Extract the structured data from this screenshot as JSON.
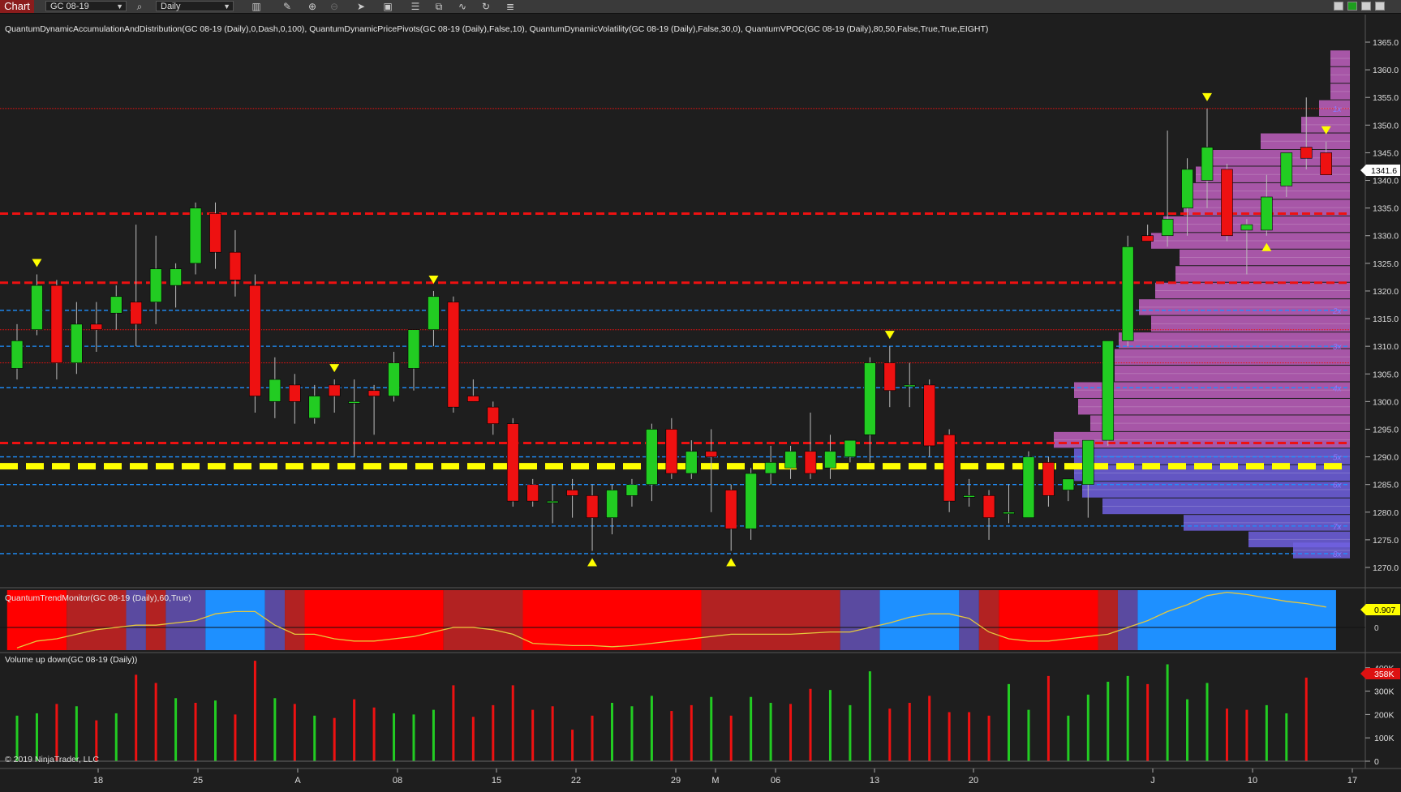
{
  "toolbar": {
    "chart_tab": "Chart",
    "instrument": "GC 08-19",
    "interval": "Daily",
    "icons": [
      "bar-type-icon",
      "pencil-icon",
      "zoom-in-icon",
      "zoom-out-icon",
      "pointer-icon",
      "data-box-icon",
      "properties-icon",
      "strategies-icon",
      "indicators-icon",
      "refresh-icon",
      "menu-icon"
    ],
    "window_colors": {
      "minimize": "#cccccc",
      "maximize": "#1e9e1e",
      "close": "#cfcfcf"
    }
  },
  "main_panel": {
    "indicators_label": "QuantumDynamicAccumulationAndDistribution(GC 08-19 (Daily),0,Dash,0,100), QuantumDynamicPricePivots(GC 08-19 (Daily),False,10), QuantumDynamicVolatility(GC 08-19 (Daily),False,30,0), QuantumVPOC(GC 08-19 (Daily),80,50,False,True,True,EIGHT)",
    "current_price_label": "1341.6",
    "y_ticks": [
      "1365.0",
      "1360.0",
      "1355.0",
      "1350.0",
      "1345.0",
      "1340.0",
      "1335.0",
      "1330.0",
      "1325.0",
      "1320.0",
      "1315.0",
      "1310.0",
      "1305.0",
      "1300.0",
      "1295.0",
      "1290.0",
      "1285.0",
      "1280.0",
      "1275.0",
      "1270.0"
    ],
    "vpoc_markers": [
      "1x",
      "2x",
      "3x",
      "4x",
      "5x",
      "6x",
      "7x",
      "8x"
    ]
  },
  "trend_panel": {
    "label": "QuantumTrendMonitor(GC 08-19 (Daily),60,True)",
    "value_badge": "0.907",
    "zero_label": "0"
  },
  "volume_panel": {
    "label": "Volume up down(GC 08-19 (Daily))",
    "badge": "358K",
    "y_ticks": [
      "400K",
      "300K",
      "200K",
      "100K",
      "0"
    ],
    "copyright": "© 2019 NinjaTrader, LLC"
  },
  "x_axis": {
    "labels": [
      "18",
      "25",
      "A",
      "08",
      "15",
      "22",
      "29",
      "M",
      "06",
      "13",
      "20",
      "J",
      "10",
      "17"
    ]
  },
  "colors": {
    "background": "#1e1e1e",
    "up_candle": "#22cc22",
    "down_candle": "#ee1111",
    "pivot_marker": "#ffff00",
    "vpoc_line": "#ffff00",
    "resistance_line": "#ee1111",
    "volatility_line": "#1e90ff",
    "profile_up": "#c060c0",
    "profile_down": "#7060e0",
    "trend_line": "#e6c83c"
  },
  "chart_data": {
    "type": "candlestick",
    "ylim": [
      1267,
      1368
    ],
    "candles": [
      {
        "o": 1306,
        "h": 1314,
        "l": 1304,
        "c": 1311
      },
      {
        "o": 1313,
        "h": 1323,
        "l": 1312,
        "c": 1321
      },
      {
        "o": 1321,
        "h": 1322,
        "l": 1304,
        "c": 1307
      },
      {
        "o": 1307,
        "h": 1318,
        "l": 1305,
        "c": 1314
      },
      {
        "o": 1314,
        "h": 1318,
        "l": 1309,
        "c": 1313
      },
      {
        "o": 1316,
        "h": 1321,
        "l": 1313,
        "c": 1319
      },
      {
        "o": 1318,
        "h": 1332,
        "l": 1310,
        "c": 1314
      },
      {
        "o": 1318,
        "h": 1330,
        "l": 1314,
        "c": 1324
      },
      {
        "o": 1321,
        "h": 1325,
        "l": 1317,
        "c": 1324
      },
      {
        "o": 1325,
        "h": 1336,
        "l": 1323,
        "c": 1335
      },
      {
        "o": 1334,
        "h": 1336,
        "l": 1324,
        "c": 1327
      },
      {
        "o": 1327,
        "h": 1331,
        "l": 1319,
        "c": 1322
      },
      {
        "o": 1321,
        "h": 1323,
        "l": 1298,
        "c": 1301
      },
      {
        "o": 1300,
        "h": 1308,
        "l": 1297,
        "c": 1304
      },
      {
        "o": 1303,
        "h": 1305,
        "l": 1296,
        "c": 1300
      },
      {
        "o": 1297,
        "h": 1303,
        "l": 1296,
        "c": 1301
      },
      {
        "o": 1303,
        "h": 1304,
        "l": 1298,
        "c": 1301
      },
      {
        "o": 1300,
        "h": 1304,
        "l": 1290,
        "c": 1300
      },
      {
        "o": 1302,
        "h": 1303,
        "l": 1294,
        "c": 1301
      },
      {
        "o": 1301,
        "h": 1309,
        "l": 1300,
        "c": 1307
      },
      {
        "o": 1306,
        "h": 1312,
        "l": 1302,
        "c": 1313
      },
      {
        "o": 1313,
        "h": 1320,
        "l": 1310,
        "c": 1319
      },
      {
        "o": 1318,
        "h": 1319,
        "l": 1298,
        "c": 1299
      },
      {
        "o": 1301,
        "h": 1304,
        "l": 1300,
        "c": 1300
      },
      {
        "o": 1299,
        "h": 1300,
        "l": 1294,
        "c": 1296
      },
      {
        "o": 1296,
        "h": 1297,
        "l": 1281,
        "c": 1282
      },
      {
        "o": 1285,
        "h": 1286,
        "l": 1281,
        "c": 1282
      },
      {
        "o": 1282,
        "h": 1285,
        "l": 1278,
        "c": 1282
      },
      {
        "o": 1284,
        "h": 1286,
        "l": 1279,
        "c": 1283
      },
      {
        "o": 1283,
        "h": 1285,
        "l": 1273,
        "c": 1279
      },
      {
        "o": 1279,
        "h": 1285,
        "l": 1276,
        "c": 1284
      },
      {
        "o": 1283,
        "h": 1286,
        "l": 1281,
        "c": 1285
      },
      {
        "o": 1285,
        "h": 1296,
        "l": 1282,
        "c": 1295
      },
      {
        "o": 1295,
        "h": 1297,
        "l": 1286,
        "c": 1287
      },
      {
        "o": 1287,
        "h": 1293,
        "l": 1286,
        "c": 1291
      },
      {
        "o": 1291,
        "h": 1295,
        "l": 1280,
        "c": 1290
      },
      {
        "o": 1284,
        "h": 1285,
        "l": 1273,
        "c": 1277
      },
      {
        "o": 1277,
        "h": 1288,
        "l": 1275,
        "c": 1287
      },
      {
        "o": 1287,
        "h": 1292,
        "l": 1285,
        "c": 1289
      },
      {
        "o": 1288,
        "h": 1292,
        "l": 1286,
        "c": 1291
      },
      {
        "o": 1291,
        "h": 1298,
        "l": 1286,
        "c": 1287
      },
      {
        "o": 1288,
        "h": 1294,
        "l": 1286,
        "c": 1291
      },
      {
        "o": 1290,
        "h": 1293,
        "l": 1289,
        "c": 1293
      },
      {
        "o": 1294,
        "h": 1308,
        "l": 1289,
        "c": 1307
      },
      {
        "o": 1307,
        "h": 1310,
        "l": 1299,
        "c": 1302
      },
      {
        "o": 1303,
        "h": 1307,
        "l": 1299,
        "c": 1303
      },
      {
        "o": 1303,
        "h": 1304,
        "l": 1290,
        "c": 1292
      },
      {
        "o": 1294,
        "h": 1295,
        "l": 1280,
        "c": 1282
      },
      {
        "o": 1283,
        "h": 1286,
        "l": 1281,
        "c": 1283
      },
      {
        "o": 1283,
        "h": 1284,
        "l": 1275,
        "c": 1279
      },
      {
        "o": 1280,
        "h": 1285,
        "l": 1278,
        "c": 1280
      },
      {
        "o": 1279,
        "h": 1291,
        "l": 1279,
        "c": 1290
      },
      {
        "o": 1289,
        "h": 1290,
        "l": 1281,
        "c": 1283
      },
      {
        "o": 1284,
        "h": 1286,
        "l": 1282,
        "c": 1286
      },
      {
        "o": 1285,
        "h": 1293,
        "l": 1279,
        "c": 1293
      },
      {
        "o": 1293,
        "h": 1311,
        "l": 1292,
        "c": 1311
      },
      {
        "o": 1311,
        "h": 1330,
        "l": 1310,
        "c": 1328
      },
      {
        "o": 1330,
        "h": 1332,
        "l": 1330,
        "c": 1329
      },
      {
        "o": 1330,
        "h": 1349,
        "l": 1328,
        "c": 1333
      },
      {
        "o": 1335,
        "h": 1344,
        "l": 1330,
        "c": 1342
      },
      {
        "o": 1340,
        "h": 1353,
        "l": 1335,
        "c": 1346
      },
      {
        "o": 1342,
        "h": 1343,
        "l": 1329,
        "c": 1330
      },
      {
        "o": 1331,
        "h": 1333,
        "l": 1323,
        "c": 1332
      },
      {
        "o": 1331,
        "h": 1341,
        "l": 1330,
        "c": 1337
      },
      {
        "o": 1339,
        "h": 1345,
        "l": 1337,
        "c": 1345
      },
      {
        "o": 1346,
        "h": 1355,
        "l": 1342,
        "c": 1344
      },
      {
        "o": 1345,
        "h": 1347,
        "l": 1341,
        "c": 1341
      }
    ],
    "horizontal_lines": [
      {
        "price": 1353,
        "style": "thin-red"
      },
      {
        "price": 1334,
        "style": "thick-red-dash"
      },
      {
        "price": 1321.5,
        "style": "thick-red-dash"
      },
      {
        "price": 1316.5,
        "style": "blue-dash"
      },
      {
        "price": 1313,
        "style": "thin-red"
      },
      {
        "price": 1310,
        "style": "blue-dash"
      },
      {
        "price": 1307,
        "style": "thin-red"
      },
      {
        "price": 1302.5,
        "style": "blue-dash"
      },
      {
        "price": 1292.5,
        "style": "thick-red-dash"
      },
      {
        "price": 1290,
        "style": "blue-dash"
      },
      {
        "price": 1288.3,
        "style": "thick-yellow-dash"
      },
      {
        "price": 1285,
        "style": "blue-dash"
      },
      {
        "price": 1277.5,
        "style": "blue-dash"
      },
      {
        "price": 1272.5,
        "style": "blue-dash"
      }
    ],
    "pivot_highs": [
      1,
      21,
      16,
      44,
      60,
      66
    ],
    "pivot_lows": [
      29,
      36,
      63
    ],
    "volume_profile": [
      {
        "p": 1362,
        "w": 24,
        "up": true
      },
      {
        "p": 1359,
        "w": 24,
        "up": true
      },
      {
        "p": 1356,
        "w": 24,
        "up": true
      },
      {
        "p": 1353,
        "w": 38,
        "up": true
      },
      {
        "p": 1350,
        "w": 60,
        "up": true
      },
      {
        "p": 1347,
        "w": 110,
        "up": true
      },
      {
        "p": 1344,
        "w": 170,
        "up": true
      },
      {
        "p": 1341,
        "w": 190,
        "up": true
      },
      {
        "p": 1338,
        "w": 200,
        "up": true
      },
      {
        "p": 1335,
        "w": 205,
        "up": true
      },
      {
        "p": 1332,
        "w": 230,
        "up": true
      },
      {
        "p": 1329,
        "w": 245,
        "up": true
      },
      {
        "p": 1326,
        "w": 210,
        "up": true
      },
      {
        "p": 1323,
        "w": 215,
        "up": true
      },
      {
        "p": 1320,
        "w": 240,
        "up": true
      },
      {
        "p": 1317,
        "w": 260,
        "up": true
      },
      {
        "p": 1314,
        "w": 245,
        "up": true
      },
      {
        "p": 1311,
        "w": 285,
        "up": true
      },
      {
        "p": 1308,
        "w": 290,
        "up": true
      },
      {
        "p": 1305,
        "w": 290,
        "up": true
      },
      {
        "p": 1302,
        "w": 340,
        "up": true
      },
      {
        "p": 1299,
        "w": 335,
        "up": true
      },
      {
        "p": 1296,
        "w": 320,
        "up": true
      },
      {
        "p": 1293,
        "w": 365,
        "up": true
      },
      {
        "p": 1290,
        "w": 340,
        "up": false
      },
      {
        "p": 1287,
        "w": 340,
        "up": false
      },
      {
        "p": 1284,
        "w": 330,
        "up": false
      },
      {
        "p": 1281,
        "w": 305,
        "up": false
      },
      {
        "p": 1278,
        "w": 205,
        "up": false
      },
      {
        "p": 1275,
        "w": 125,
        "up": false
      },
      {
        "p": 1273,
        "w": 70,
        "up": false
      }
    ],
    "trend_segments": [
      {
        "from": 0,
        "to": 3,
        "color": "#ff0000"
      },
      {
        "from": 3,
        "to": 6,
        "color": "#b22222"
      },
      {
        "from": 6,
        "to": 7,
        "color": "#5a4aa0"
      },
      {
        "from": 7,
        "to": 8,
        "color": "#b22222"
      },
      {
        "from": 8,
        "to": 10,
        "color": "#5a4aa0"
      },
      {
        "from": 10,
        "to": 13,
        "color": "#1e90ff"
      },
      {
        "from": 13,
        "to": 14,
        "color": "#5a4aa0"
      },
      {
        "from": 14,
        "to": 15,
        "color": "#b22222"
      },
      {
        "from": 15,
        "to": 22,
        "color": "#ff0000"
      },
      {
        "from": 22,
        "to": 26,
        "color": "#b22222"
      },
      {
        "from": 26,
        "to": 35,
        "color": "#ff0000"
      },
      {
        "from": 35,
        "to": 42,
        "color": "#b22222"
      },
      {
        "from": 42,
        "to": 44,
        "color": "#5a4aa0"
      },
      {
        "from": 44,
        "to": 48,
        "color": "#1e90ff"
      },
      {
        "from": 48,
        "to": 49,
        "color": "#5a4aa0"
      },
      {
        "from": 49,
        "to": 50,
        "color": "#b22222"
      },
      {
        "from": 50,
        "to": 55,
        "color": "#ff0000"
      },
      {
        "from": 55,
        "to": 56,
        "color": "#b22222"
      },
      {
        "from": 56,
        "to": 57,
        "color": "#5a4aa0"
      },
      {
        "from": 57,
        "to": 67,
        "color": "#1e90ff"
      }
    ],
    "trend_values": [
      -0.9,
      -0.6,
      -0.5,
      -0.3,
      -0.1,
      0.0,
      0.1,
      0.1,
      0.2,
      0.3,
      0.6,
      0.7,
      0.7,
      0.1,
      -0.3,
      -0.3,
      -0.5,
      -0.6,
      -0.6,
      -0.5,
      -0.4,
      -0.2,
      0.0,
      0.0,
      -0.1,
      -0.3,
      -0.7,
      -0.75,
      -0.8,
      -0.8,
      -0.85,
      -0.8,
      -0.7,
      -0.6,
      -0.5,
      -0.4,
      -0.3,
      -0.3,
      -0.3,
      -0.3,
      -0.25,
      -0.2,
      -0.2,
      0.0,
      0.2,
      0.45,
      0.6,
      0.6,
      0.4,
      -0.2,
      -0.5,
      -0.6,
      -0.6,
      -0.5,
      -0.4,
      -0.3,
      0.0,
      0.3,
      0.7,
      1.0,
      1.4,
      1.55,
      1.45,
      1.3,
      1.15,
      1.05,
      0.9
    ],
    "volumes": [
      {
        "v": 195,
        "up": true
      },
      {
        "v": 205,
        "up": true
      },
      {
        "v": 245,
        "up": false
      },
      {
        "v": 235,
        "up": true
      },
      {
        "v": 175,
        "up": false
      },
      {
        "v": 205,
        "up": true
      },
      {
        "v": 370,
        "up": false
      },
      {
        "v": 335,
        "up": false
      },
      {
        "v": 270,
        "up": true
      },
      {
        "v": 250,
        "up": false
      },
      {
        "v": 260,
        "up": true
      },
      {
        "v": 200,
        "up": false
      },
      {
        "v": 430,
        "up": false
      },
      {
        "v": 270,
        "up": true
      },
      {
        "v": 245,
        "up": false
      },
      {
        "v": 195,
        "up": true
      },
      {
        "v": 185,
        "up": false
      },
      {
        "v": 265,
        "up": false
      },
      {
        "v": 230,
        "up": false
      },
      {
        "v": 205,
        "up": true
      },
      {
        "v": 200,
        "up": true
      },
      {
        "v": 220,
        "up": true
      },
      {
        "v": 325,
        "up": false
      },
      {
        "v": 190,
        "up": false
      },
      {
        "v": 240,
        "up": false
      },
      {
        "v": 325,
        "up": false
      },
      {
        "v": 220,
        "up": false
      },
      {
        "v": 235,
        "up": false
      },
      {
        "v": 135,
        "up": false
      },
      {
        "v": 195,
        "up": false
      },
      {
        "v": 250,
        "up": true
      },
      {
        "v": 235,
        "up": true
      },
      {
        "v": 280,
        "up": true
      },
      {
        "v": 215,
        "up": false
      },
      {
        "v": 240,
        "up": false
      },
      {
        "v": 275,
        "up": true
      },
      {
        "v": 195,
        "up": false
      },
      {
        "v": 275,
        "up": true
      },
      {
        "v": 250,
        "up": true
      },
      {
        "v": 245,
        "up": false
      },
      {
        "v": 310,
        "up": false
      },
      {
        "v": 305,
        "up": true
      },
      {
        "v": 240,
        "up": true
      },
      {
        "v": 385,
        "up": true
      },
      {
        "v": 225,
        "up": false
      },
      {
        "v": 250,
        "up": false
      },
      {
        "v": 280,
        "up": false
      },
      {
        "v": 210,
        "up": false
      },
      {
        "v": 210,
        "up": false
      },
      {
        "v": 195,
        "up": false
      },
      {
        "v": 330,
        "up": true
      },
      {
        "v": 220,
        "up": true
      },
      {
        "v": 365,
        "up": false
      },
      {
        "v": 195,
        "up": true
      },
      {
        "v": 285,
        "up": true
      },
      {
        "v": 340,
        "up": true
      },
      {
        "v": 365,
        "up": true
      },
      {
        "v": 330,
        "up": false
      },
      {
        "v": 415,
        "up": true
      },
      {
        "v": 265,
        "up": true
      },
      {
        "v": 335,
        "up": true
      },
      {
        "v": 225,
        "up": false
      },
      {
        "v": 220,
        "up": false
      },
      {
        "v": 240,
        "up": true
      },
      {
        "v": 205,
        "up": true
      },
      {
        "v": 358,
        "up": false
      }
    ]
  }
}
